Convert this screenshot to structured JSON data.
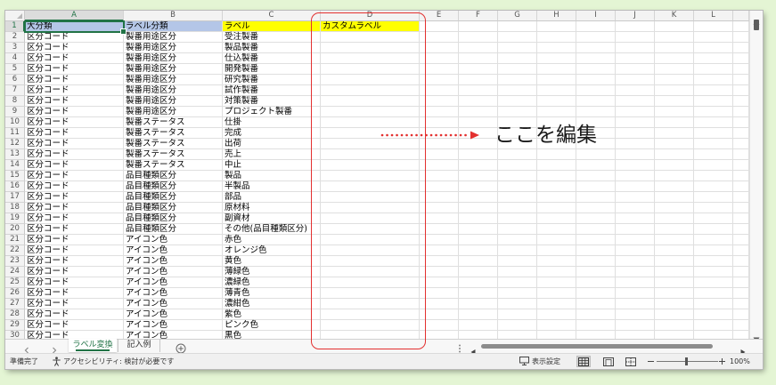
{
  "colors": {
    "background": "#e4f5d4",
    "accent_green": "#217346",
    "annotation_red": "#e3302f"
  },
  "sheet": {
    "columns": [
      "A",
      "B",
      "C",
      "D",
      "E",
      "F",
      "G",
      "H",
      "I",
      "J",
      "K",
      "L",
      ""
    ],
    "header_fills": [
      "#b4c6e7",
      "#b4c6e7",
      "#ffff00",
      "#ffff00"
    ],
    "rows": [
      {
        "num": "1",
        "cells": [
          "大分類",
          "ラベル分類",
          "ラベル",
          "カスタムラベル"
        ]
      },
      {
        "num": "2",
        "cells": [
          "区分コード",
          "製番用途区分",
          "受注製番"
        ]
      },
      {
        "num": "3",
        "cells": [
          "区分コード",
          "製番用途区分",
          "製品製番"
        ]
      },
      {
        "num": "4",
        "cells": [
          "区分コード",
          "製番用途区分",
          "仕込製番"
        ]
      },
      {
        "num": "5",
        "cells": [
          "区分コード",
          "製番用途区分",
          "開発製番"
        ]
      },
      {
        "num": "6",
        "cells": [
          "区分コード",
          "製番用途区分",
          "研究製番"
        ]
      },
      {
        "num": "7",
        "cells": [
          "区分コード",
          "製番用途区分",
          "試作製番"
        ]
      },
      {
        "num": "8",
        "cells": [
          "区分コード",
          "製番用途区分",
          "対策製番"
        ]
      },
      {
        "num": "9",
        "cells": [
          "区分コード",
          "製番用途区分",
          "プロジェクト製番"
        ]
      },
      {
        "num": "10",
        "cells": [
          "区分コード",
          "製番ステータス",
          "仕掛"
        ]
      },
      {
        "num": "11",
        "cells": [
          "区分コード",
          "製番ステータス",
          "完成"
        ]
      },
      {
        "num": "12",
        "cells": [
          "区分コード",
          "製番ステータス",
          "出荷"
        ]
      },
      {
        "num": "13",
        "cells": [
          "区分コード",
          "製番ステータス",
          "売上"
        ]
      },
      {
        "num": "14",
        "cells": [
          "区分コード",
          "製番ステータス",
          "中止"
        ]
      },
      {
        "num": "15",
        "cells": [
          "区分コード",
          "品目種類区分",
          "製品"
        ]
      },
      {
        "num": "16",
        "cells": [
          "区分コード",
          "品目種類区分",
          "半製品"
        ]
      },
      {
        "num": "17",
        "cells": [
          "区分コード",
          "品目種類区分",
          "部品"
        ]
      },
      {
        "num": "18",
        "cells": [
          "区分コード",
          "品目種類区分",
          "原材料"
        ]
      },
      {
        "num": "19",
        "cells": [
          "区分コード",
          "品目種類区分",
          "副資材"
        ]
      },
      {
        "num": "20",
        "cells": [
          "区分コード",
          "品目種類区分",
          "その他(品目種類区分)"
        ]
      },
      {
        "num": "21",
        "cells": [
          "区分コード",
          "アイコン色",
          "赤色"
        ]
      },
      {
        "num": "22",
        "cells": [
          "区分コード",
          "アイコン色",
          "オレンジ色"
        ]
      },
      {
        "num": "23",
        "cells": [
          "区分コード",
          "アイコン色",
          "黄色"
        ]
      },
      {
        "num": "24",
        "cells": [
          "区分コード",
          "アイコン色",
          "薄緑色"
        ]
      },
      {
        "num": "25",
        "cells": [
          "区分コード",
          "アイコン色",
          "濃緑色"
        ]
      },
      {
        "num": "26",
        "cells": [
          "区分コード",
          "アイコン色",
          "薄青色"
        ]
      },
      {
        "num": "27",
        "cells": [
          "区分コード",
          "アイコン色",
          "濃紺色"
        ]
      },
      {
        "num": "28",
        "cells": [
          "区分コード",
          "アイコン色",
          "紫色"
        ]
      },
      {
        "num": "29",
        "cells": [
          "区分コード",
          "アイコン色",
          "ピンク色"
        ]
      },
      {
        "num": "30",
        "cells": [
          "区分コード",
          "アイコン色",
          "黒色"
        ]
      }
    ]
  },
  "annotation": {
    "text": "ここを編集"
  },
  "tabs": [
    {
      "label": "ラベル変換",
      "active": true
    },
    {
      "label": "記入例",
      "active": false
    }
  ],
  "status": {
    "ready": "準備完了",
    "accessibility": "アクセシビリティ: 検討が必要です",
    "display_settings": "表示設定",
    "zoom": "100%"
  },
  "icons": {
    "previous_sheet": "chevron-left-icon",
    "next_sheet": "chevron-right-icon",
    "add_sheet": "plus-circle-icon",
    "tab_split": "vertical-dots-icon",
    "scroll_left": "triangle-left-icon",
    "scroll_right": "triangle-right-icon",
    "scroll_up": "triangle-up-icon",
    "scroll_down": "triangle-down-icon",
    "accessibility": "accessibility-person-icon",
    "display_settings": "monitor-icon",
    "normal_view": "grid-view-icon",
    "page_layout_view": "page-layout-icon",
    "page_break_preview": "page-break-icon",
    "zoom_out": "minus-icon",
    "zoom_in": "plus-icon"
  }
}
